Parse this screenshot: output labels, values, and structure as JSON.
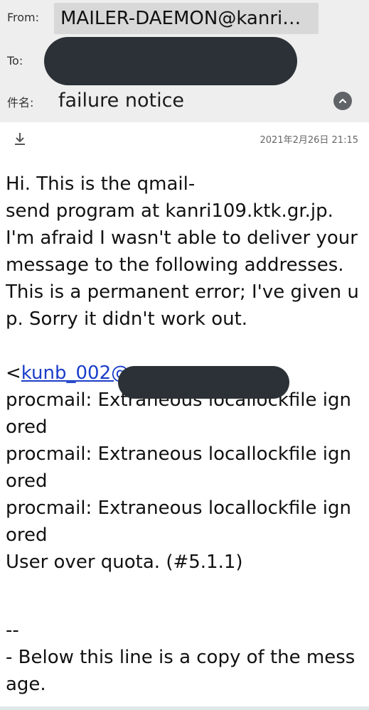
{
  "header": {
    "from_label": "From:",
    "from_value": "MAILER-DAEMON@kanri…",
    "to_label": "To:",
    "subject_label": "件名:",
    "subject_value": "failure notice"
  },
  "meta": {
    "timestamp": "2021年2月26日 21:15"
  },
  "body": {
    "lines": [
      "Hi. This is the qmail-",
      "send program at kanri109.ktk.gr.jp.",
      "I'm afraid I wasn't able to deliver your",
      "message to the following addresses.",
      "This is a permanent error; I've given u",
      "p. Sorry it didn't work out."
    ],
    "address_prefix": "<",
    "address_visible": "kunb_002@",
    "log_lines": [
      "procmail: Extraneous locallockfile ign",
      "ored",
      "procmail: Extraneous locallockfile ign",
      "ored",
      "procmail: Extraneous locallockfile ign",
      "ored",
      "User over quota. (#5.1.1)"
    ],
    "separator": "--",
    "footer_lines": [
      "- Below this line is a copy of the mess",
      "age."
    ]
  },
  "icons": {
    "download": "download-icon",
    "collapse": "chevron-up-icon"
  },
  "colors": {
    "header_bg": "#eeeeee",
    "chip_bg": "#d8d8d8",
    "redaction": "#2b3136",
    "link": "#1a3ec9"
  }
}
